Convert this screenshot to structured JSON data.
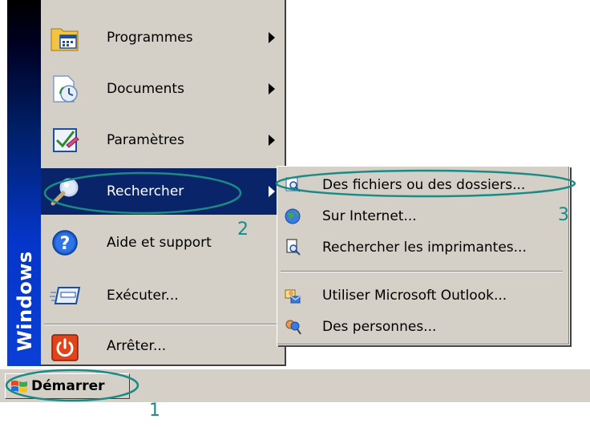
{
  "start_menu": {
    "brand": "Windows",
    "items": [
      {
        "label": "Programmes",
        "icon": "programs-folder-icon",
        "has_submenu": true
      },
      {
        "label": "Documents",
        "icon": "documents-icon",
        "has_submenu": true
      },
      {
        "label": "Paramètres",
        "icon": "settings-icon",
        "has_submenu": true
      },
      {
        "label": "Rechercher",
        "icon": "magnifier-icon",
        "has_submenu": true,
        "highlighted": true
      },
      {
        "label": "Aide et support",
        "icon": "help-icon",
        "has_submenu": false
      },
      {
        "label": "Exécuter...",
        "icon": "run-icon",
        "has_submenu": false
      },
      {
        "label": "Arrêter...",
        "icon": "shutdown-icon",
        "has_submenu": false
      }
    ]
  },
  "search_submenu": {
    "items": [
      {
        "label": "Des fichiers ou des dossiers...",
        "icon": "find-files-icon"
      },
      {
        "label": "Sur Internet...",
        "icon": "globe-search-icon"
      },
      {
        "label": "Rechercher les imprimantes...",
        "icon": "find-printer-icon"
      },
      {
        "label": "Utiliser Microsoft Outlook...",
        "icon": "outlook-icon"
      },
      {
        "label": "Des personnes...",
        "icon": "people-icon"
      }
    ]
  },
  "taskbar": {
    "start_label": "Démarrer"
  },
  "annotations": {
    "step1": "1",
    "step2": "2",
    "step3": "3"
  },
  "colors": {
    "menu_bg": "#d4d0c8",
    "highlight": "#0a246a",
    "brand_strip": "#0a3fd7",
    "annotation": "#1a8a84"
  }
}
